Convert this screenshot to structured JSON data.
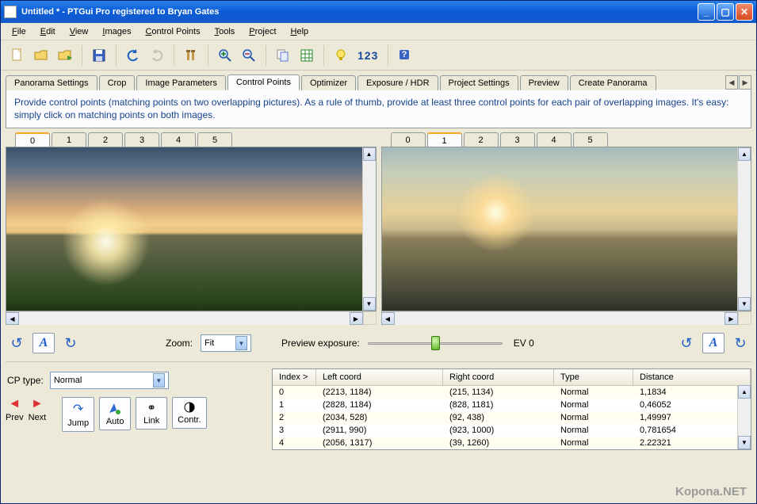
{
  "title": "Untitled * - PTGui Pro registered to Bryan Gates",
  "menu": [
    "File",
    "Edit",
    "View",
    "Images",
    "Control Points",
    "Tools",
    "Project",
    "Help"
  ],
  "toolbar_text": "123",
  "tabs": [
    "Panorama Settings",
    "Crop",
    "Image Parameters",
    "Control Points",
    "Optimizer",
    "Exposure / HDR",
    "Project Settings",
    "Preview",
    "Create Panorama"
  ],
  "active_tab": "Control Points",
  "info_text": "Provide control points (matching points on two overlapping pictures). As a rule of thumb, provide at least three control points for each pair of overlapping images. It's easy: simply click on matching points on both images.",
  "left_image_tabs": [
    "0",
    "1",
    "2",
    "3",
    "4",
    "5"
  ],
  "left_image_active": "0",
  "right_image_tabs": [
    "0",
    "1",
    "2",
    "3",
    "4",
    "5"
  ],
  "right_image_active": "1",
  "zoom_label": "Zoom:",
  "zoom_value": "Fit",
  "preview_exposure_label": "Preview exposure:",
  "ev_label": "EV 0",
  "letter_button": "A",
  "cp_type_label": "CP type:",
  "cp_type_value": "Normal",
  "nav": {
    "prev": "Prev",
    "next": "Next"
  },
  "actions": {
    "jump": "Jump",
    "auto": "Auto",
    "link": "Link",
    "contr": "Contr."
  },
  "table": {
    "headers": {
      "index": "Index >",
      "left": "Left coord",
      "right": "Right coord",
      "type": "Type",
      "dist": "Distance"
    },
    "rows": [
      {
        "i": "0",
        "l": "(2213, 1184)",
        "r": "(215, 1134)",
        "t": "Normal",
        "d": "1,1834"
      },
      {
        "i": "1",
        "l": "(2828, 1184)",
        "r": "(828, 1181)",
        "t": "Normal",
        "d": "0,46052"
      },
      {
        "i": "2",
        "l": "(2034, 528)",
        "r": "(92, 438)",
        "t": "Normal",
        "d": "1,49997"
      },
      {
        "i": "3",
        "l": "(2911, 990)",
        "r": "(923, 1000)",
        "t": "Normal",
        "d": "0,781654"
      },
      {
        "i": "4",
        "l": "(2056, 1317)",
        "r": "(39, 1260)",
        "t": "Normal",
        "d": "2.22321"
      }
    ]
  },
  "watermark": "Kopona.NET"
}
